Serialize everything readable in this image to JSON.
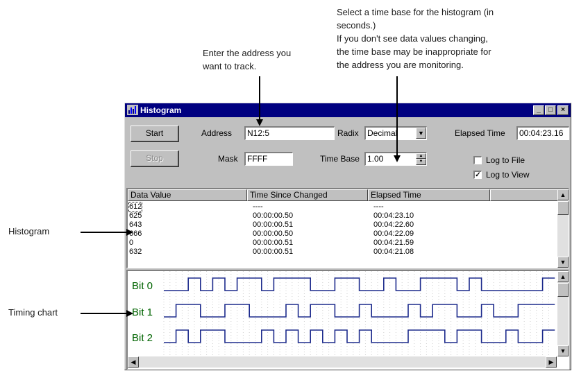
{
  "annotations": {
    "timebase_note": [
      "Select a time base for the histogram (in",
      "seconds.)",
      "If you don't see data values changing,",
      "the time base may be inappropriate for",
      "the address you are monitoring."
    ],
    "address_note": [
      "Enter the address you",
      "want to track."
    ],
    "histogram_label": "Histogram",
    "timing_label": "Timing chart"
  },
  "window": {
    "title": "Histogram",
    "title_icon": "histogram-app-icon",
    "controls": {
      "minimize": "_",
      "maximize": "□",
      "close": "×"
    }
  },
  "form": {
    "start_label": "Start",
    "stop_label": "Stop",
    "address_label": "Address",
    "address_value": "N12:5",
    "mask_label": "Mask",
    "mask_value": "FFFF",
    "radix_label": "Radix",
    "radix_value": "Decimal",
    "timebase_label": "Time Base",
    "timebase_value": "1.00",
    "elapsed_label": "Elapsed Time",
    "elapsed_value": "00:04:23.16",
    "log_to_file_label": "Log to File",
    "log_to_file_checked": false,
    "log_to_view_label": "Log to View",
    "log_to_view_checked": true
  },
  "table": {
    "columns": [
      "Data Value",
      "Time Since Changed",
      "Elapsed Time"
    ],
    "rows": [
      [
        "612",
        "----",
        "----"
      ],
      [
        "625",
        "00:00:00.50",
        "00:04:23.10"
      ],
      [
        "643",
        "00:00:00.51",
        "00:04:22.60"
      ],
      [
        "666",
        "00:00:00.50",
        "00:04:22.09"
      ],
      [
        "0",
        "00:00:00.51",
        "00:04:21.59"
      ],
      [
        "632",
        "00:00:00.51",
        "00:04:21.08"
      ]
    ]
  },
  "timing": {
    "signal_color": "#1c2a8c",
    "bits": [
      {
        "label": "Bit 0",
        "transitions": [
          0,
          0,
          1,
          0,
          1,
          0,
          1,
          1,
          0,
          1,
          1,
          1,
          0,
          0,
          1,
          1,
          0,
          0,
          1,
          0,
          0,
          1,
          1,
          1,
          0,
          1,
          0,
          0,
          0,
          0,
          0,
          1
        ]
      },
      {
        "label": "Bit 1",
        "transitions": [
          0,
          1,
          1,
          0,
          0,
          1,
          1,
          0,
          0,
          0,
          1,
          0,
          1,
          1,
          0,
          0,
          1,
          0,
          0,
          0,
          1,
          0,
          1,
          1,
          0,
          0,
          1,
          0,
          0,
          1,
          1,
          1
        ]
      },
      {
        "label": "Bit 2",
        "transitions": [
          0,
          1,
          0,
          1,
          1,
          0,
          0,
          0,
          1,
          0,
          1,
          0,
          1,
          0,
          1,
          0,
          1,
          0,
          0,
          0,
          1,
          1,
          1,
          0,
          1,
          1,
          0,
          0,
          1,
          0,
          0,
          1
        ]
      }
    ]
  }
}
